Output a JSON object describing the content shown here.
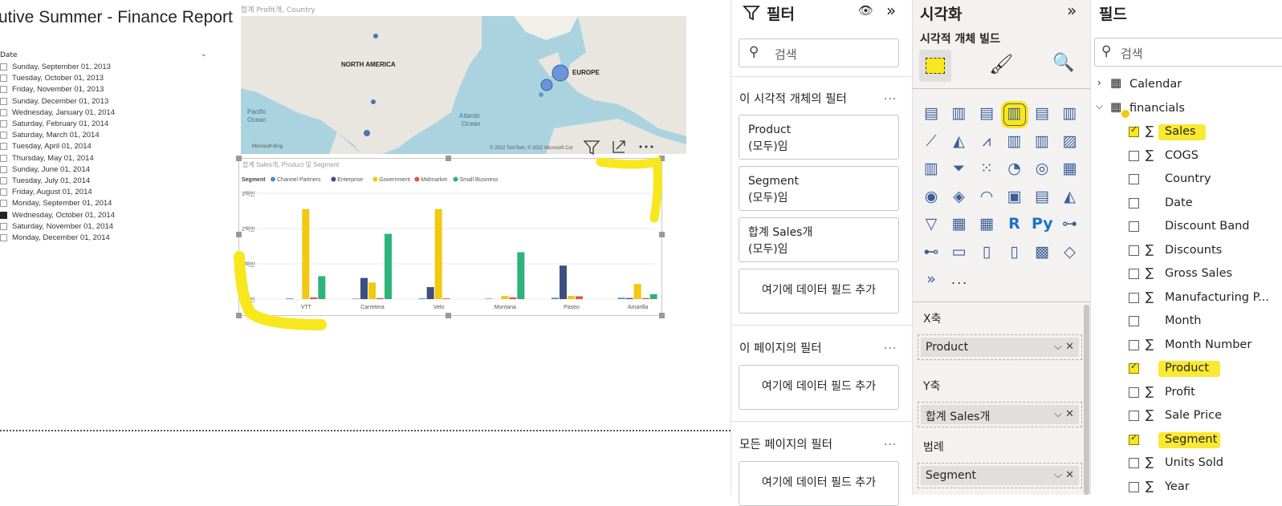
{
  "report": {
    "title": "utive Summer - Finance Report"
  },
  "slicer": {
    "header": "Date",
    "items": [
      {
        "label": "Sunday, September 01, 2013",
        "checked": false
      },
      {
        "label": "Tuesday, October 01, 2013",
        "checked": false
      },
      {
        "label": "Friday, November 01, 2013",
        "checked": false
      },
      {
        "label": "Sunday, December 01, 2013",
        "checked": false
      },
      {
        "label": "Wednesday, January 01, 2014",
        "checked": false
      },
      {
        "label": "Saturday, February 01, 2014",
        "checked": false
      },
      {
        "label": "Saturday, March 01, 2014",
        "checked": false
      },
      {
        "label": "Tuesday, April 01, 2014",
        "checked": false
      },
      {
        "label": "Thursday, May 01, 2014",
        "checked": false
      },
      {
        "label": "Sunday, June 01, 2014",
        "checked": false
      },
      {
        "label": "Tuesday, July 01, 2014",
        "checked": false
      },
      {
        "label": "Friday, August 01, 2014",
        "checked": false
      },
      {
        "label": "Monday, September 01, 2014",
        "checked": false
      },
      {
        "label": "Wednesday, October 01, 2014",
        "checked": true
      },
      {
        "label": "Saturday, November 01, 2014",
        "checked": false
      },
      {
        "label": "Monday, December 01, 2014",
        "checked": false
      }
    ]
  },
  "map": {
    "title": "합계 Profit개, Country",
    "labels": {
      "north_america": "NORTH AMERICA",
      "europe": "EUROPE",
      "pacific": "Pacific\nOcean",
      "atlantic": "Atlantic\nOcean"
    },
    "attribution": "© 2022 TomTom, © 2022 Microsoft Cor",
    "bing": "Microsoft Bing"
  },
  "chart_data": {
    "type": "bar",
    "title": "합계 Sales개, Product 및 Segment",
    "legend_title": "Segment",
    "categories": [
      "VTT",
      "Carretera",
      "Velo",
      "Montana",
      "Paseo",
      "Amarilla"
    ],
    "y_ticks": [
      "0백만",
      "1백만",
      "2백만",
      "3백만"
    ],
    "ylim": [
      0,
      3000000
    ],
    "series": [
      {
        "name": "Channel Partners",
        "color": "#4a90d9",
        "values": [
          20000,
          15000,
          20000,
          15000,
          40000,
          40000
        ]
      },
      {
        "name": "Enterprise",
        "color": "#3b4f81",
        "values": [
          0,
          600000,
          340000,
          0,
          950000,
          30000
        ]
      },
      {
        "name": "Government",
        "color": "#f2c811",
        "values": [
          2550000,
          470000,
          2550000,
          90000,
          90000,
          430000
        ]
      },
      {
        "name": "Midmarket",
        "color": "#e0534e",
        "values": [
          50000,
          30000,
          20000,
          50000,
          80000,
          30000
        ]
      },
      {
        "name": "Small Business",
        "color": "#2db37a",
        "values": [
          650000,
          1850000,
          0,
          1330000,
          0,
          140000
        ]
      }
    ]
  },
  "filter_pane": {
    "title": "필터",
    "search_placeholder": "검색",
    "visual_section": "이 시각적 개체의 필터",
    "cards": [
      {
        "line1": "Product",
        "line2": "(모두)임"
      },
      {
        "line1": "Segment",
        "line2": "(모두)임"
      },
      {
        "line1": "합계 Sales개",
        "line2": "(모두)임"
      }
    ],
    "add_field": "여기에 데이터 필드 추가",
    "page_section": "이 페이지의 필터",
    "all_section": "모든 페이지의 필터",
    "more": "..."
  },
  "viz_pane": {
    "title": "시각화",
    "subtitle": "시각적 개체 빌드",
    "more": "...",
    "wells": [
      {
        "label": "X축",
        "value": "Product"
      },
      {
        "label": "Y축",
        "value": "합계 Sales개"
      },
      {
        "label": "범례",
        "value": "Segment"
      }
    ]
  },
  "fields_pane": {
    "title": "필드",
    "search_placeholder": "검색",
    "tables": [
      {
        "name": "Calendar",
        "expanded": false
      },
      {
        "name": "financials",
        "expanded": true
      }
    ],
    "fields": [
      {
        "name": "Sales",
        "sigma": true,
        "checked": true
      },
      {
        "name": "COGS",
        "sigma": true,
        "checked": false
      },
      {
        "name": "Country",
        "sigma": false,
        "checked": false
      },
      {
        "name": "Date",
        "sigma": false,
        "checked": false
      },
      {
        "name": "Discount Band",
        "sigma": false,
        "checked": false
      },
      {
        "name": "Discounts",
        "sigma": true,
        "checked": false
      },
      {
        "name": "Gross Sales",
        "sigma": true,
        "checked": false
      },
      {
        "name": "Manufacturing P...",
        "sigma": true,
        "checked": false
      },
      {
        "name": "Month",
        "sigma": false,
        "checked": false
      },
      {
        "name": "Month Number",
        "sigma": true,
        "checked": false
      },
      {
        "name": "Product",
        "sigma": false,
        "checked": true
      },
      {
        "name": "Profit",
        "sigma": true,
        "checked": false
      },
      {
        "name": "Sale Price",
        "sigma": true,
        "checked": false
      },
      {
        "name": "Segment",
        "sigma": false,
        "checked": true
      },
      {
        "name": "Units Sold",
        "sigma": true,
        "checked": false
      },
      {
        "name": "Year",
        "sigma": true,
        "checked": false
      }
    ]
  }
}
